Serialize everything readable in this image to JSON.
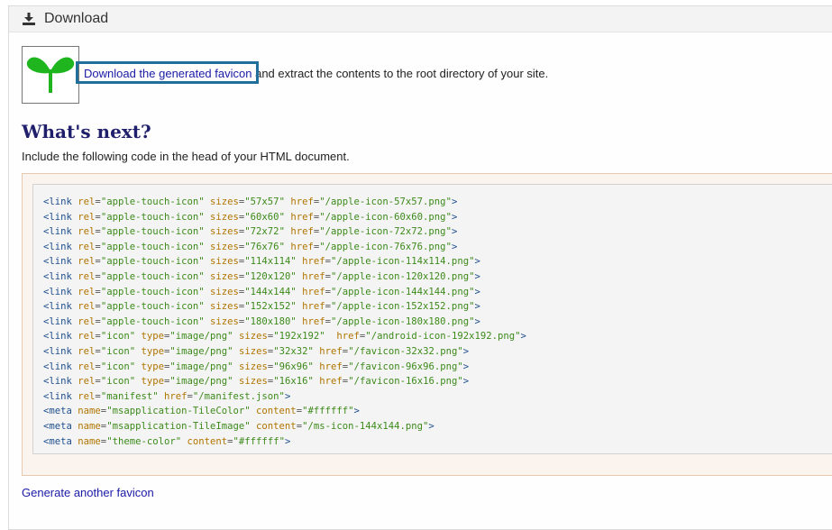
{
  "header": {
    "title": "Download",
    "icon": "download-icon"
  },
  "download": {
    "link_text": "Download the generated favicon",
    "rest_text": "and extract the contents to the root directory of your site."
  },
  "next": {
    "heading": "What's next?",
    "intro": "Include the following code in the head of your HTML document."
  },
  "code_lines": [
    {
      "tag": "link",
      "attrs": [
        {
          "n": "rel",
          "v": "apple-touch-icon"
        },
        {
          "n": "sizes",
          "v": "57x57"
        },
        {
          "n": "href",
          "v": "/apple-icon-57x57.png"
        }
      ]
    },
    {
      "tag": "link",
      "attrs": [
        {
          "n": "rel",
          "v": "apple-touch-icon"
        },
        {
          "n": "sizes",
          "v": "60x60"
        },
        {
          "n": "href",
          "v": "/apple-icon-60x60.png"
        }
      ]
    },
    {
      "tag": "link",
      "attrs": [
        {
          "n": "rel",
          "v": "apple-touch-icon"
        },
        {
          "n": "sizes",
          "v": "72x72"
        },
        {
          "n": "href",
          "v": "/apple-icon-72x72.png"
        }
      ]
    },
    {
      "tag": "link",
      "attrs": [
        {
          "n": "rel",
          "v": "apple-touch-icon"
        },
        {
          "n": "sizes",
          "v": "76x76"
        },
        {
          "n": "href",
          "v": "/apple-icon-76x76.png"
        }
      ]
    },
    {
      "tag": "link",
      "attrs": [
        {
          "n": "rel",
          "v": "apple-touch-icon"
        },
        {
          "n": "sizes",
          "v": "114x114"
        },
        {
          "n": "href",
          "v": "/apple-icon-114x114.png"
        }
      ]
    },
    {
      "tag": "link",
      "attrs": [
        {
          "n": "rel",
          "v": "apple-touch-icon"
        },
        {
          "n": "sizes",
          "v": "120x120"
        },
        {
          "n": "href",
          "v": "/apple-icon-120x120.png"
        }
      ]
    },
    {
      "tag": "link",
      "attrs": [
        {
          "n": "rel",
          "v": "apple-touch-icon"
        },
        {
          "n": "sizes",
          "v": "144x144"
        },
        {
          "n": "href",
          "v": "/apple-icon-144x144.png"
        }
      ]
    },
    {
      "tag": "link",
      "attrs": [
        {
          "n": "rel",
          "v": "apple-touch-icon"
        },
        {
          "n": "sizes",
          "v": "152x152"
        },
        {
          "n": "href",
          "v": "/apple-icon-152x152.png"
        }
      ]
    },
    {
      "tag": "link",
      "attrs": [
        {
          "n": "rel",
          "v": "apple-touch-icon"
        },
        {
          "n": "sizes",
          "v": "180x180"
        },
        {
          "n": "href",
          "v": "/apple-icon-180x180.png"
        }
      ]
    },
    {
      "tag": "link",
      "attrs": [
        {
          "n": "rel",
          "v": "icon"
        },
        {
          "n": "type",
          "v": "image/png"
        },
        {
          "n": "sizes",
          "v": "192x192"
        },
        {
          "n": " href",
          "v": "/android-icon-192x192.png"
        }
      ]
    },
    {
      "tag": "link",
      "attrs": [
        {
          "n": "rel",
          "v": "icon"
        },
        {
          "n": "type",
          "v": "image/png"
        },
        {
          "n": "sizes",
          "v": "32x32"
        },
        {
          "n": "href",
          "v": "/favicon-32x32.png"
        }
      ]
    },
    {
      "tag": "link",
      "attrs": [
        {
          "n": "rel",
          "v": "icon"
        },
        {
          "n": "type",
          "v": "image/png"
        },
        {
          "n": "sizes",
          "v": "96x96"
        },
        {
          "n": "href",
          "v": "/favicon-96x96.png"
        }
      ]
    },
    {
      "tag": "link",
      "attrs": [
        {
          "n": "rel",
          "v": "icon"
        },
        {
          "n": "type",
          "v": "image/png"
        },
        {
          "n": "sizes",
          "v": "16x16"
        },
        {
          "n": "href",
          "v": "/favicon-16x16.png"
        }
      ]
    },
    {
      "tag": "link",
      "attrs": [
        {
          "n": "rel",
          "v": "manifest"
        },
        {
          "n": "href",
          "v": "/manifest.json"
        }
      ]
    },
    {
      "tag": "meta",
      "attrs": [
        {
          "n": "name",
          "v": "msapplication-TileColor"
        },
        {
          "n": "content",
          "v": "#ffffff"
        }
      ]
    },
    {
      "tag": "meta",
      "attrs": [
        {
          "n": "name",
          "v": "msapplication-TileImage"
        },
        {
          "n": "content",
          "v": "/ms-icon-144x144.png"
        }
      ]
    },
    {
      "tag": "meta",
      "attrs": [
        {
          "n": "name",
          "v": "theme-color"
        },
        {
          "n": "content",
          "v": "#ffffff"
        }
      ]
    }
  ],
  "footer_link": "Generate another favicon",
  "colors": {
    "focus_ring": "#1f6f9a",
    "link": "#1a1aa6",
    "heading": "#1f1f6b",
    "favicon_green": "#1fb51f"
  }
}
